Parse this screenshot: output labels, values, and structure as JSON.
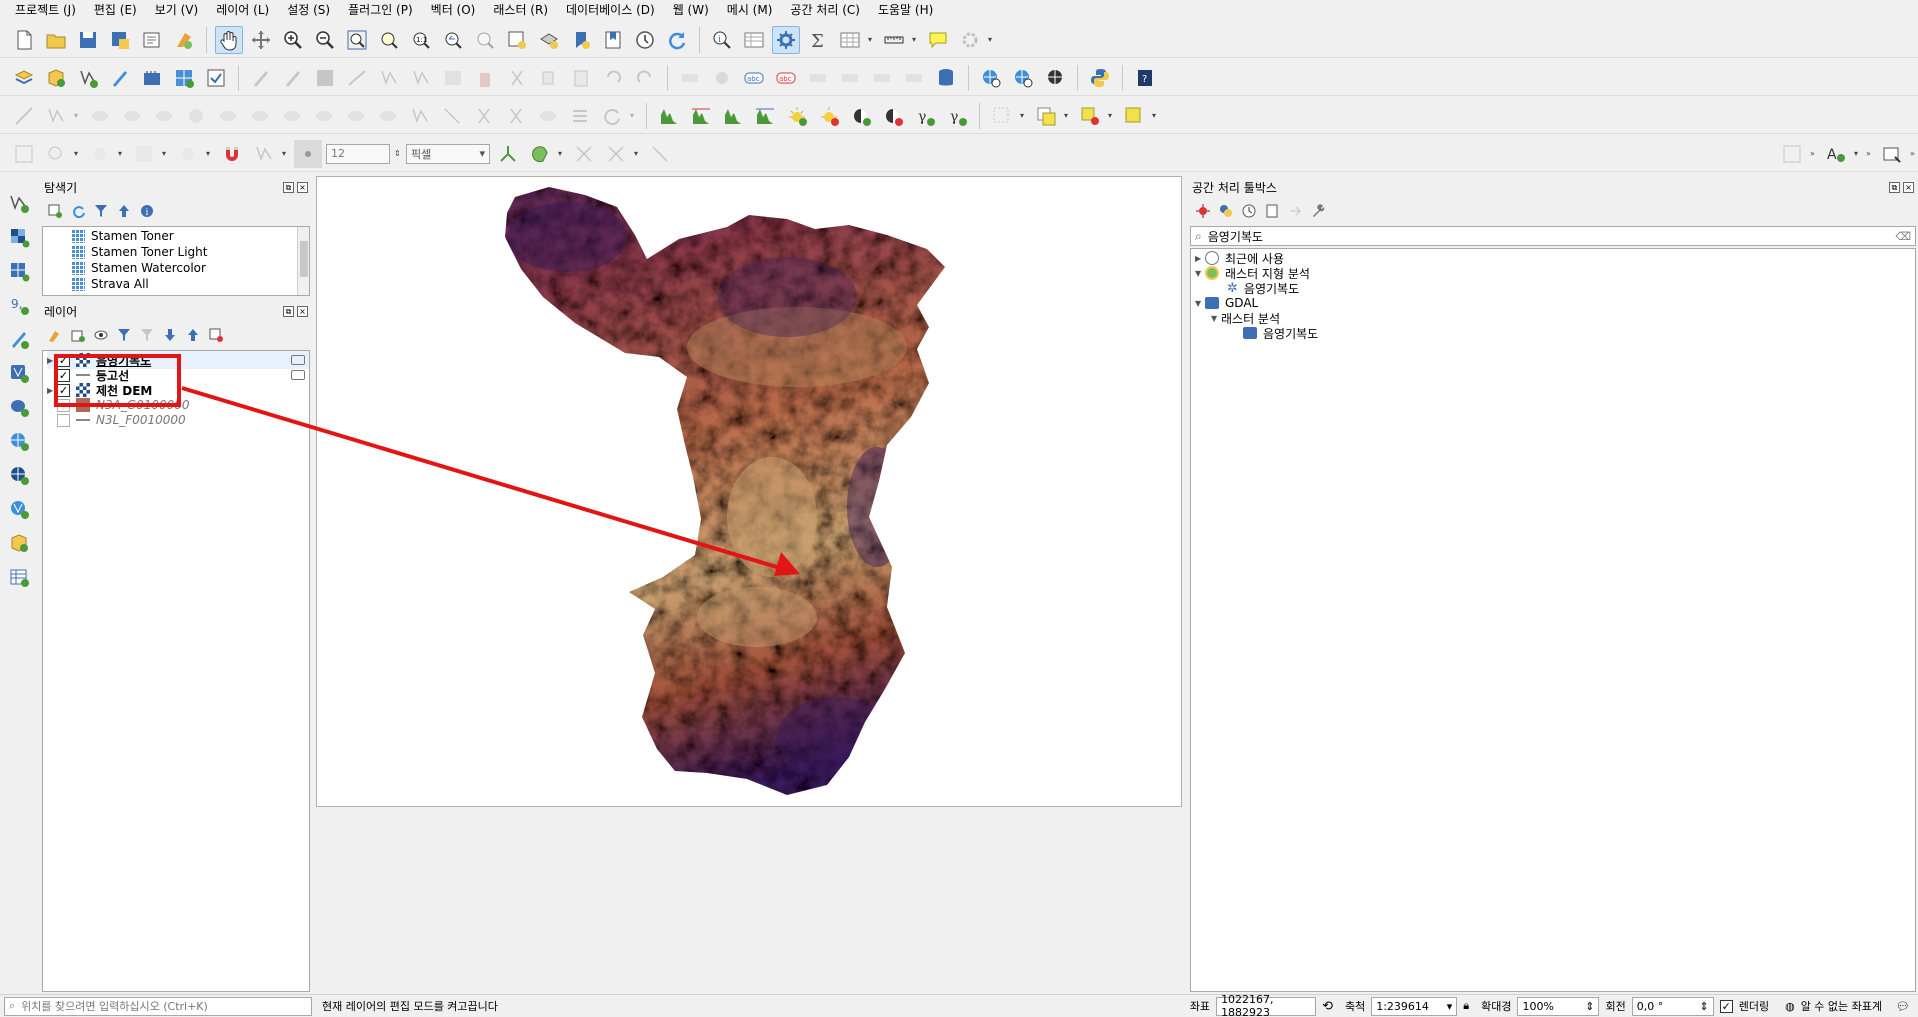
{
  "menubar": {
    "items": [
      "프로젝트 (J)",
      "편집 (E)",
      "보기 (V)",
      "레이어 (L)",
      "설정 (S)",
      "플러그인 (P)",
      "벡터 (O)",
      "래스터 (R)",
      "데이터베이스 (D)",
      "웹 (W)",
      "메시 (M)",
      "공간 처리 (C)",
      "도움말 (H)"
    ]
  },
  "snapping": {
    "tolerance": "12",
    "unit": "픽셀"
  },
  "browser_panel": {
    "title": "탐색기",
    "items": [
      "Stamen Toner",
      "Stamen Toner Light",
      "Stamen Watercolor",
      "Strava All"
    ]
  },
  "layers_panel": {
    "title": "레이어",
    "layers": [
      {
        "name": "음영기복도",
        "checked": true,
        "type": "raster",
        "bold": true
      },
      {
        "name": "등고선",
        "checked": true,
        "type": "line",
        "bold": true
      },
      {
        "name": "제천 DEM",
        "checked": true,
        "type": "raster",
        "bold": true
      },
      {
        "name": "N3A_G0100000",
        "checked": false,
        "type": "polygon",
        "bold": false
      },
      {
        "name": "N3L_F0010000",
        "checked": false,
        "type": "line",
        "bold": false
      }
    ]
  },
  "toolbox_panel": {
    "title": "공간 처리 툴박스",
    "search_value": "음영기복도",
    "tree": {
      "recent": "최근에 사용",
      "raster_terrain": "래스터 지형 분석",
      "raster_terrain_hillshade": "음영기복도",
      "gdal": "GDAL",
      "gdal_raster_analysis": "래스터 분석",
      "gdal_hillshade": "음영기복도"
    }
  },
  "statusbar": {
    "locator_placeholder": "위치를 찾으려면 입력하십시오 (Ctrl+K)",
    "message": "현재 레이어의 편집 모드를 켜고끕니다",
    "coord_label": "좌표",
    "coord_value": "1022167, 1882923",
    "scale_label": "축척",
    "scale_value": "1:239614",
    "magnifier_label": "확대경",
    "magnifier_value": "100%",
    "rotation_label": "회전",
    "rotation_value": "0,0 °",
    "render_label": "렌더링",
    "crs_label": "알 수 없는 좌표계"
  },
  "colors": {
    "accent": "#e21414",
    "hillshade_low": "#c9a070",
    "hillshade_mid": "#9a4a3a",
    "hillshade_high": "#3a1a5a"
  }
}
